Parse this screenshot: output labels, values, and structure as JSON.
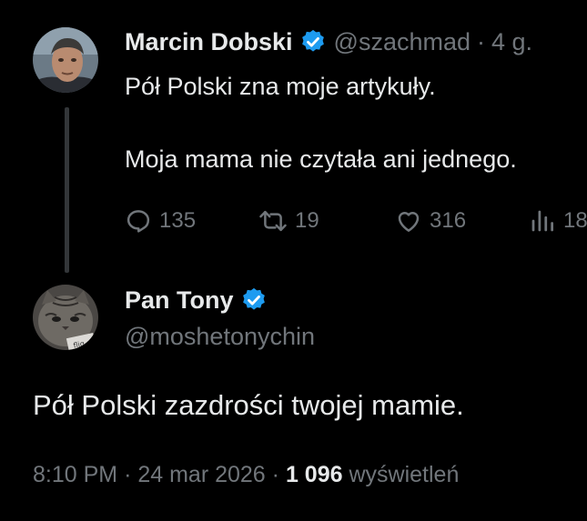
{
  "parent_tweet": {
    "author_name": "Marcin Dobski",
    "handle": "@szachmad",
    "separator": "·",
    "age": "4 g.",
    "text_line_1": "Pół Polski zna moje artykuły.",
    "text_line_2": "Moja mama nie czytała ani jednego.",
    "stats": {
      "replies": "135",
      "retweets": "19",
      "likes": "316",
      "views": "18"
    },
    "avatar_icon": "portrait-avatar-icon"
  },
  "reply_tweet": {
    "author_name": "Pan Tony",
    "handle": "@moshetonychin",
    "text": "Pół Polski zazdrości twojej mamie.",
    "time": "8:10 PM",
    "separator": "·",
    "date": "24 mar 2026",
    "views_count": "1 096",
    "views_label": "wyświetleń",
    "avatar_icon": "cat-avatar-icon",
    "avatar_text": "flig"
  },
  "colors": {
    "background": "#000000",
    "primary_text": "#e7e9ea",
    "secondary_text": "#71767b",
    "verified_badge": "#1d9bf0",
    "thread_line": "#333639"
  }
}
